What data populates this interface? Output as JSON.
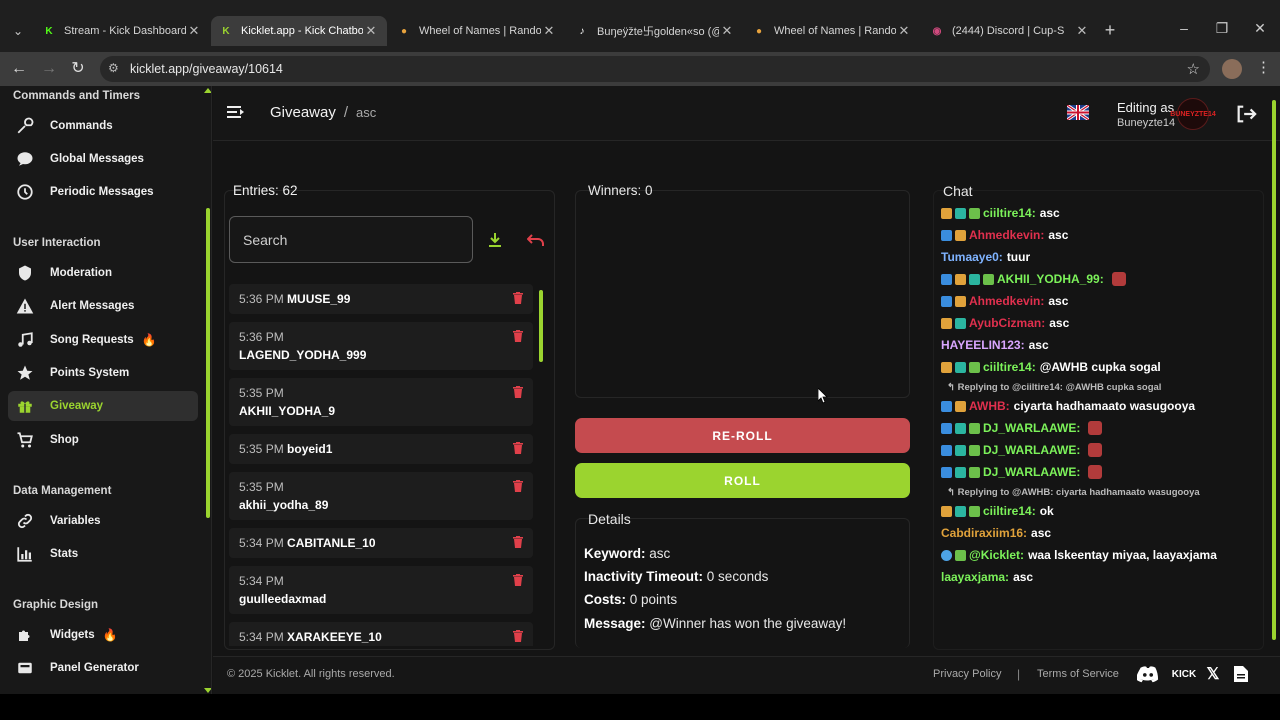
{
  "browser": {
    "tabs": [
      {
        "title": "Stream - Kick Dashboard",
        "fav": "K",
        "fav_color": "#53fc18",
        "active": false
      },
      {
        "title": "Kicklet.app - Kick Chatbot",
        "fav": "K",
        "fav_color": "#9bd42f",
        "active": true
      },
      {
        "title": "Wheel of Names | Random",
        "fav": "●",
        "fav_color": "#e8a33d",
        "active": false
      },
      {
        "title": "Buŋeÿžte卐golden«so (@bu",
        "fav": "♪",
        "fav_color": "#ffffff",
        "active": false
      },
      {
        "title": "Wheel of Names | Random",
        "fav": "●",
        "fav_color": "#e8a33d",
        "active": false
      },
      {
        "title": "(2444) Discord | Cup-S",
        "fav": "◉",
        "fav_color": "#d04a7e",
        "active": false
      }
    ],
    "url": "kicklet.app/giveaway/10614"
  },
  "sidebar": {
    "sections": [
      {
        "title": "Commands and Timers"
      },
      {
        "title": "User Interaction"
      },
      {
        "title": "Data Management"
      },
      {
        "title": "Graphic Design"
      }
    ],
    "items": [
      {
        "label": "Commands",
        "icon": "wrench-icon"
      },
      {
        "label": "Global Messages",
        "icon": "chat-bubble-icon"
      },
      {
        "label": "Periodic Messages",
        "icon": "history-icon"
      },
      {
        "label": "Moderation",
        "icon": "shield-icon"
      },
      {
        "label": "Alert Messages",
        "icon": "warning-icon"
      },
      {
        "label": "Song Requests",
        "icon": "music-note-icon",
        "badge": "🔥"
      },
      {
        "label": "Points System",
        "icon": "star-icon"
      },
      {
        "label": "Giveaway",
        "icon": "gift-icon",
        "active": true
      },
      {
        "label": "Shop",
        "icon": "cart-icon"
      },
      {
        "label": "Variables",
        "icon": "link-icon"
      },
      {
        "label": "Stats",
        "icon": "bar-chart-icon"
      },
      {
        "label": "Widgets",
        "icon": "puzzle-icon",
        "badge": "🔥"
      },
      {
        "label": "Panel Generator",
        "icon": "panel-icon"
      }
    ]
  },
  "header": {
    "breadcrumb_main": "Giveaway",
    "breadcrumb_sep": "/",
    "breadcrumb_sub": "asc",
    "editing_label": "Editing as",
    "editing_user": "Buneyzte14",
    "avatar_text": "BUNEYZTE14"
  },
  "entries_panel": {
    "title": "Entries: 62",
    "search_placeholder": "Search",
    "entries": [
      {
        "time": "5:36 PM",
        "name": "MUUSE_99",
        "inline": true
      },
      {
        "time": "5:36 PM",
        "name": "LAGEND_YODHA_999",
        "inline": false
      },
      {
        "time": "5:35 PM",
        "name": "AKHII_YODHA_9",
        "inline": false
      },
      {
        "time": "5:35 PM",
        "name": "boyeid1",
        "inline": true
      },
      {
        "time": "5:35 PM",
        "name": "akhii_yodha_89",
        "inline": false
      },
      {
        "time": "5:34 PM",
        "name": "CABITANLE_10",
        "inline": true
      },
      {
        "time": "5:34 PM",
        "name": "guulleedaxmad",
        "inline": false
      },
      {
        "time": "5:34 PM",
        "name": "XARAKEEYE_10",
        "inline": true
      }
    ]
  },
  "winners_panel": {
    "title": "Winners: 0",
    "reroll_label": "RE-ROLL",
    "roll_label": "ROLL"
  },
  "details": {
    "title": "Details",
    "keyword_label": "Keyword:",
    "keyword": "asc",
    "timeout_label": "Inactivity Timeout:",
    "timeout": "0 seconds",
    "costs_label": "Costs:",
    "costs": "0 points",
    "message_label": "Message:",
    "message": "@Winner has won the giveaway!"
  },
  "chat": {
    "title": "Chat",
    "messages": [
      {
        "badges": [
          "b2",
          "b3",
          "b4"
        ],
        "user": "ciiltire14:",
        "color": "#7cf25a",
        "text": "asc"
      },
      {
        "badges": [
          "b1",
          "b2"
        ],
        "user": "Ahmedkevin:",
        "color": "#e0304e",
        "text": "asc"
      },
      {
        "badges": [],
        "user": "Tumaaye0:",
        "color": "#7fb3ff",
        "text": "tuur"
      },
      {
        "badges": [
          "b1",
          "b2",
          "b3",
          "b4"
        ],
        "user": "AKHII_YODHA_99:",
        "color": "#7cf25a",
        "text": "",
        "emote": true
      },
      {
        "badges": [
          "b1",
          "b2"
        ],
        "user": "Ahmedkevin:",
        "color": "#e0304e",
        "text": "asc"
      },
      {
        "badges": [
          "b2",
          "b3"
        ],
        "user": "AyubCizman:",
        "color": "#e0304e",
        "text": "asc"
      },
      {
        "badges": [],
        "user": "HAYEELIN123:",
        "color": "#d9a6ff",
        "text": "asc"
      },
      {
        "badges": [
          "b2",
          "b3",
          "b4"
        ],
        "user": "ciiltire14:",
        "color": "#7cf25a",
        "text": "@AWHB cupka sogal"
      },
      {
        "reply": "Replying to @ciiltire14: @AWHB cupka sogal"
      },
      {
        "badges": [
          "b1",
          "b2"
        ],
        "user": "AWHB:",
        "color": "#e0304e",
        "text": "ciyarta hadhamaato wasugooya"
      },
      {
        "badges": [
          "b1",
          "b3",
          "b4"
        ],
        "user": "DJ_WARLAAWE:",
        "color": "#7cf25a",
        "text": "",
        "emote": true
      },
      {
        "badges": [
          "b1",
          "b3",
          "b4"
        ],
        "user": "DJ_WARLAAWE:",
        "color": "#7cf25a",
        "text": "",
        "emote": true
      },
      {
        "badges": [
          "b1",
          "b3",
          "b4"
        ],
        "user": "DJ_WARLAAWE:",
        "color": "#7cf25a",
        "text": "",
        "emote": true
      },
      {
        "reply": "Replying to @AWHB: ciyarta hadhamaato wasugooya"
      },
      {
        "badges": [
          "b2",
          "b3",
          "b4"
        ],
        "user": "ciiltire14:",
        "color": "#7cf25a",
        "text": "ok"
      },
      {
        "badges": [],
        "user": "Cabdiraxiim16:",
        "color": "#e0a23b",
        "text": "asc"
      },
      {
        "badges": [
          "b5",
          "b4"
        ],
        "user": "@Kicklet:",
        "color": "#7cf25a",
        "text": "waa lskeentay miyaa, laayaxjama"
      },
      {
        "badges": [],
        "user": "laayaxjama:",
        "color": "#7cf25a",
        "text": "asc"
      }
    ]
  },
  "footer": {
    "copyright": "© 2025 Kicklet. All rights reserved.",
    "privacy": "Privacy Policy",
    "separator": "|",
    "terms": "Terms of Service",
    "kick_text": "KICK"
  }
}
